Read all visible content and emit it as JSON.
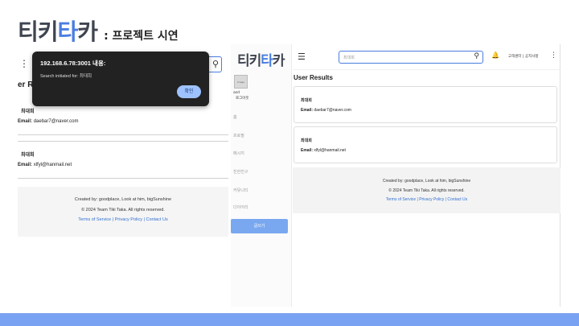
{
  "slide": {
    "logo": "티키타카",
    "subtitle": ": 프로젝트 시연",
    "bottom_bar_color": "#7aa2f2",
    "accent_color": "#4a7de0"
  },
  "alert": {
    "host": "192.168.6.78:3001 내용:",
    "message": "Search initiated for: 최대희",
    "ok_label": "확인"
  },
  "left_view": {
    "heading": "er Re",
    "results": [
      {
        "name": "최대희",
        "email_label": "Email:",
        "email": "daebar7@naver.com",
        "email_prefix": "Email:"
      },
      {
        "name": "최대희",
        "email_label": "Email:",
        "email": "xlfyl@hanmail.net",
        "email_prefix": "Email:"
      }
    ],
    "left_email_prefix_1": "Email:",
    "left_email_prefix_2": "Email:"
  },
  "sidebar": {
    "logo": "티키타카",
    "avatar_alt": "image",
    "username": "asd",
    "logout": "로그아웃",
    "items": [
      "홈",
      "프로필",
      "메시지",
      "친한친구",
      "커뮤니티",
      "다이어리"
    ],
    "write_button": "글쓰기"
  },
  "topbar": {
    "search_value": "최대희",
    "links": "고객센터 | 공지사항"
  },
  "main": {
    "results_title": "User Results",
    "results": [
      {
        "name": "최대희",
        "email_label": "Email:",
        "email": "daebar7@naver.com"
      },
      {
        "name": "최대희",
        "email_label": "Email:",
        "email": "xlfyl@hanmail.net"
      }
    ]
  },
  "footer": {
    "created_by": "Created by: goodplace, Look at him, bigSunshine",
    "copyright": "© 2024 Team Tiki Taka. All rights reserved.",
    "terms": "Terms of Service",
    "privacy": "Privacy Policy",
    "contact": "Contact Us",
    "separator": "|"
  }
}
